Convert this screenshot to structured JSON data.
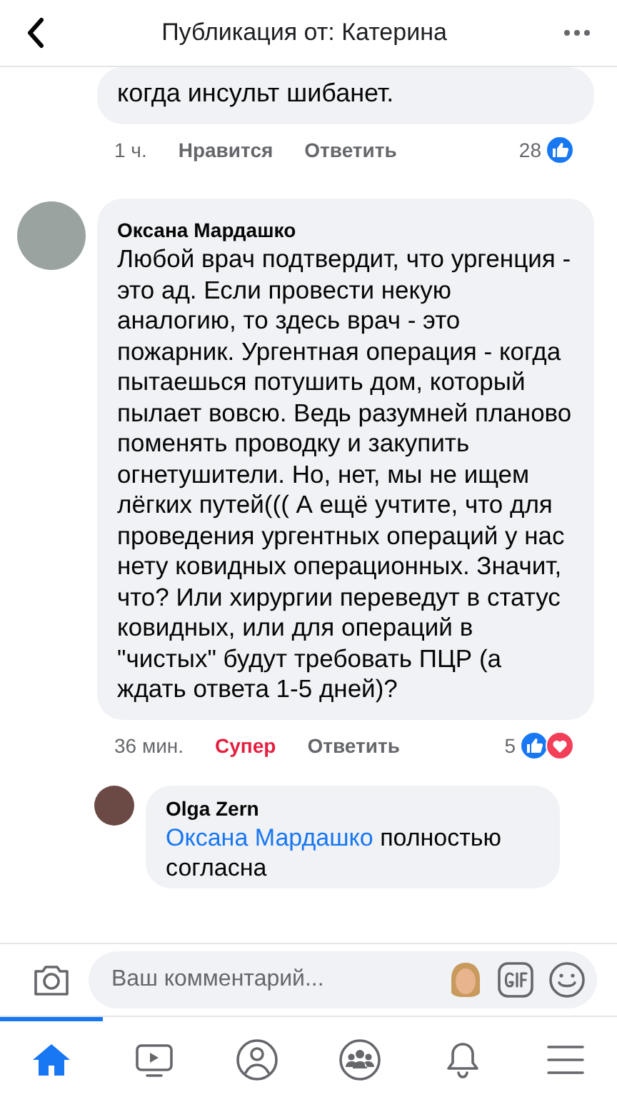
{
  "header": {
    "title": "Публикация от: Катерина"
  },
  "comments": [
    {
      "kind": "partial",
      "text": "когда инсульт шибанет.",
      "time": "1 ч.",
      "reaction_label": "Нравится",
      "reacted": false,
      "reply_label": "Ответить",
      "count": "28",
      "reactions": [
        {
          "kind": "like"
        }
      ]
    },
    {
      "kind": "full",
      "author": "Оксана Мардашко",
      "text": "Любой врач подтвердит, что ургенция - это ад. Если провести некую аналогию, то здесь врач - это пожарник. Ургентная операция - когда пытаешься потушить дом, который пылает вовсю. Ведь разумней планово поменять проводку и закупить огнетушители. Но, нет, мы не ищем лёгких путей((( А ещё учтите, что для проведения ургентных операций у нас нету ковидных операционных. Значит, что? Или хирургии переведут в статус ковидных, или для операций в \"чистых\" будут требовать ПЦР (а ждать ответа 1-5 дней)?",
      "time": "36 мин.",
      "reaction_label": "Супер",
      "reacted": true,
      "reply_label": "Ответить",
      "count": "5",
      "reactions": [
        {
          "kind": "like"
        },
        {
          "kind": "love"
        }
      ]
    }
  ],
  "reply": {
    "author": "Olga Zern",
    "mention": "Оксана Мардашко",
    "text": "полностью согласна"
  },
  "composer": {
    "placeholder": "Ваш комментарий..."
  },
  "tabs": [
    {
      "kind": "home",
      "selected": true
    },
    {
      "kind": "video",
      "selected": false
    },
    {
      "kind": "profile",
      "selected": false
    },
    {
      "kind": "groups",
      "selected": false
    },
    {
      "kind": "bell",
      "selected": false
    },
    {
      "kind": "menu",
      "selected": false
    }
  ]
}
